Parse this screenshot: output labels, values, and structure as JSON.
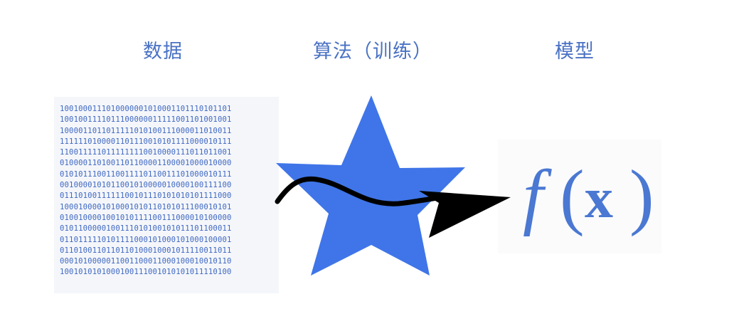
{
  "labels": {
    "data": "数据",
    "algorithm": "算法（训练）",
    "model": "模型"
  },
  "binary_lines": [
    "1001000111010000001010001101110101101",
    "1001001111011100000011111001101001001",
    "1000011011011111010100111000011010011",
    "1111110100001101110010101111000010111",
    "1100111110111111110010000111011011001",
    "0100001101001101100001100001000010000",
    "0101011100110011110110011101000010111",
    "0010000101011001010000010000100111100",
    "0111010011111100101110101010101111000",
    "1000100001010001010110101011100010101",
    "0100100001001010111100111000010100000",
    "0101100000100111010100101011101100011",
    "0110111110101111000101000101000100001",
    "0110100110110110100010001011110011011",
    "0001010000011001100011000100010010110",
    "1001010101000100111001010101011110100"
  ],
  "model_formula": {
    "function": "f",
    "open_paren": "(",
    "variable": "x",
    "close_paren": ")"
  },
  "colors": {
    "label": "#4a72c4",
    "binary": "#3f68c2",
    "star": "#3f75e8",
    "arrow": "#000000",
    "formula": "#4a78d2"
  },
  "icons": {
    "algorithm": "star-icon",
    "flow": "curved-arrow-icon"
  }
}
